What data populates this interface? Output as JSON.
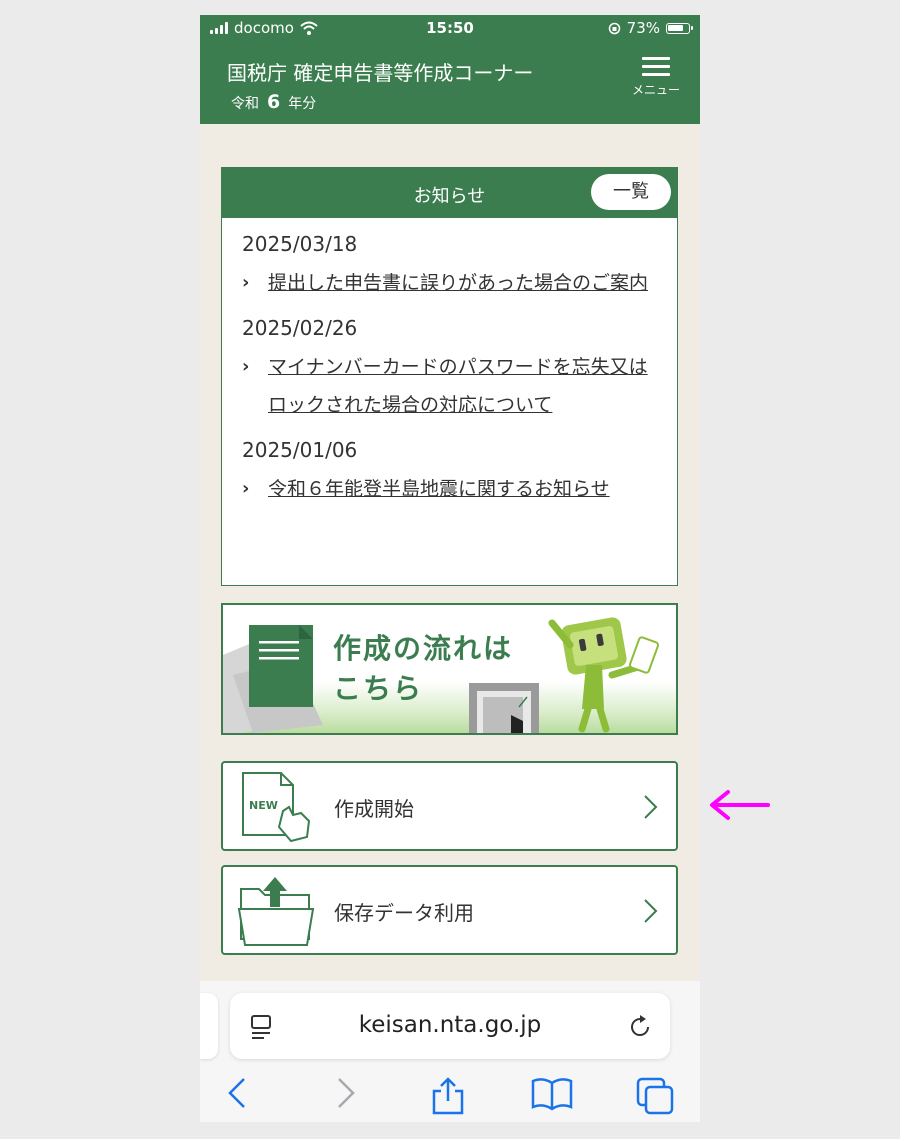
{
  "status_bar": {
    "carrier": "docomo",
    "time": "15:50",
    "battery": "73%"
  },
  "header": {
    "title": "国税庁 確定申告書等作成コーナー",
    "era": "令和",
    "year": "6",
    "year_suffix": "年分",
    "menu_label": "メニュー"
  },
  "notice": {
    "title": "お知らせ",
    "list_button": "一覧",
    "items": [
      {
        "date": "2025/03/18",
        "text": "提出した申告書に誤りがあった場合のご案内"
      },
      {
        "date": "2025/02/26",
        "text": "マイナンバーカードのパスワードを忘失又はロックされた場合の対応について"
      },
      {
        "date": "2025/01/06",
        "text": "令和６年能登半島地震に関するお知らせ"
      }
    ]
  },
  "banner": {
    "line1": "作成の流れは",
    "line2": "こちら"
  },
  "actions": [
    {
      "label": "作成開始",
      "icon": "new-document-icon",
      "icon_text": "NEW"
    },
    {
      "label": "保存データ利用",
      "icon": "folder-upload-icon"
    }
  ],
  "browser": {
    "url": "keisan.nta.go.jp"
  },
  "colors": {
    "brand_green": "#3b7d4f",
    "annotation_arrow": "#ff00ff",
    "link_blue": "#1a73e8"
  }
}
